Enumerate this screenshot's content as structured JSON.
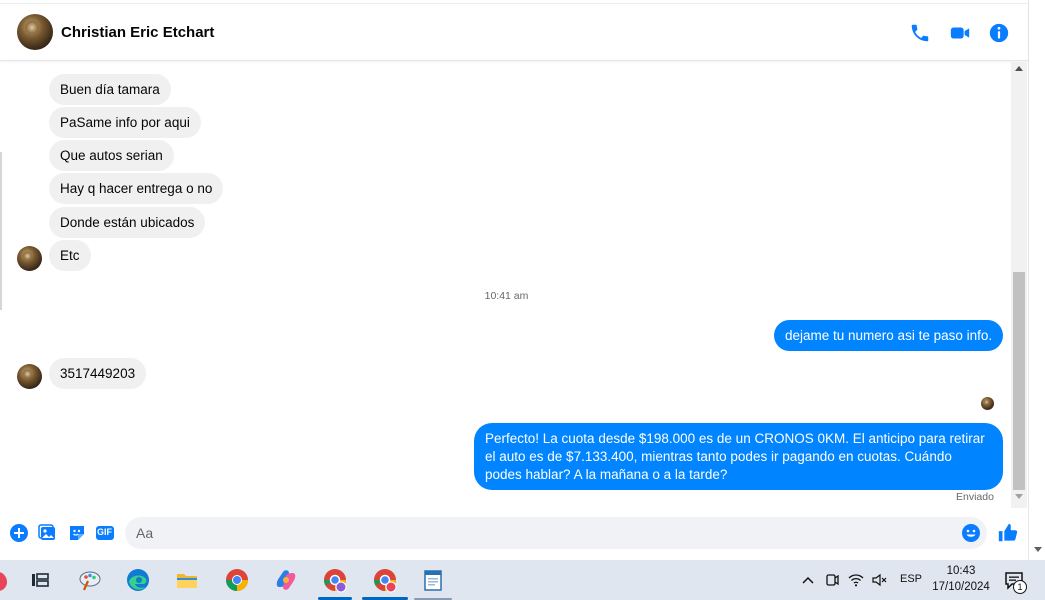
{
  "header": {
    "contact_name": "Christian Eric Etchart"
  },
  "messages": {
    "incoming_group_1": [
      "Buen día tamara",
      "PaSame info por aqui",
      "Que autos serian",
      "Hay q hacer entrega o no",
      "Donde están ubicados",
      "Etc"
    ],
    "timestamp": "10:41 am",
    "outgoing_1": "dejame tu numero asi te paso info.",
    "incoming_2": "3517449203",
    "outgoing_2": "Perfecto! La cuota desde $198.000 es de un CRONOS 0KM. El anticipo para retirar el auto es de $7.133.400, mientras tanto podes ir pagando en cuotas. Cuándo podes hablar? A la mañana o a la tarde?",
    "status": "Enviado"
  },
  "composer": {
    "placeholder": "Aa",
    "gif_label": "GIF"
  },
  "colors": {
    "accent": "#0084ff",
    "incoming_bubble": "#f0f0f0",
    "header_icons": "#0a7cff"
  },
  "taskbar": {
    "language": "ESP",
    "time": "10:43",
    "date": "17/10/2024",
    "notification_count": "1"
  }
}
